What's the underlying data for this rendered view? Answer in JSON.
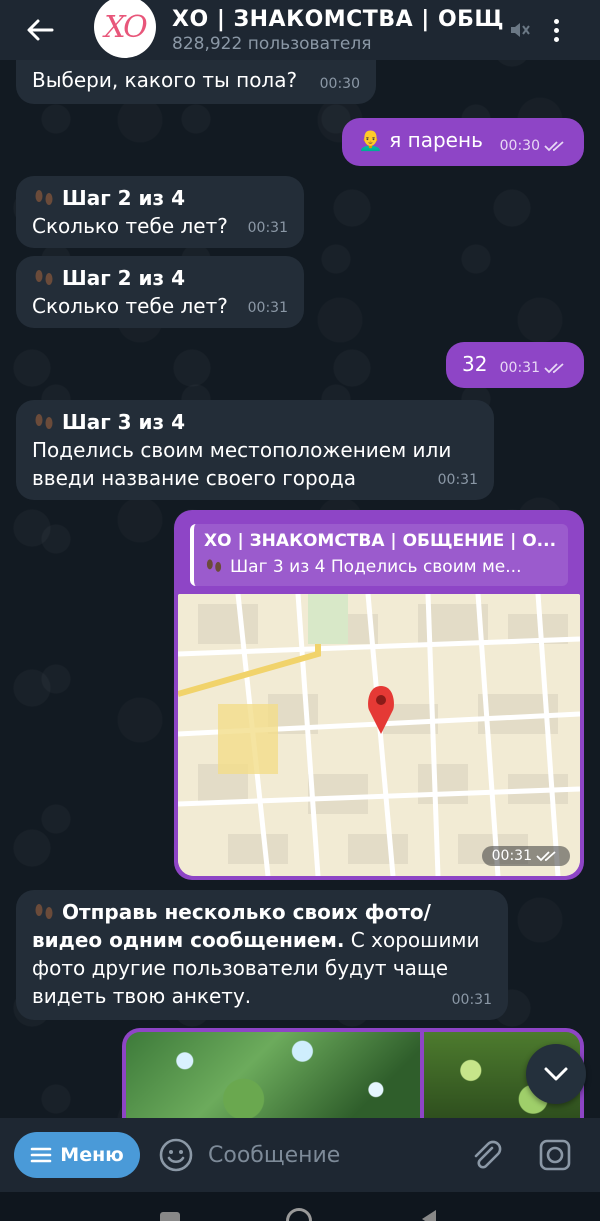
{
  "header": {
    "avatar_text": "XO",
    "title": "ХО | ЗНАКОМСТВА | ОБЩЕНИЕ",
    "subtitle": "828,922 пользователя"
  },
  "messages": [
    {
      "direction": "in",
      "text": "Выбери, какого ты пола?",
      "time": "00:30"
    },
    {
      "direction": "out",
      "emoji": "👨‍🦲",
      "text": "я парень",
      "time": "00:30"
    },
    {
      "direction": "in",
      "step": "Шаг 2 из 4",
      "text": "Сколько тебе лет?",
      "time": "00:31"
    },
    {
      "direction": "in",
      "step": "Шаг 2 из 4",
      "text": "Сколько тебе лет?",
      "time": "00:31"
    },
    {
      "direction": "out",
      "text": "32",
      "time": "00:31"
    },
    {
      "direction": "in",
      "step": "Шаг 3 из 4",
      "text": "Поделись своим местоположением или введи название своего города",
      "time": "00:31"
    },
    {
      "direction": "out",
      "type": "location",
      "reply_title": "ХО | ЗНАКОМСТВА | ОБЩЕНИЕ | О...",
      "reply_text": "Шаг 3 из 4 Поделись своим ме...",
      "time": "00:31"
    },
    {
      "direction": "in",
      "bold": "Отправь несколько своих фото/видео одним сообщением.",
      "text": " С хорошими фото другие пользователи будут чаще видеть твою анкету.",
      "time": "00:31"
    }
  ],
  "input": {
    "menu_label": "Меню",
    "placeholder": "Сообщение"
  },
  "colors": {
    "outgoing_bubble": "#8e45c6",
    "incoming_bubble": "#232d38",
    "menu_button": "#4a9ad8"
  }
}
